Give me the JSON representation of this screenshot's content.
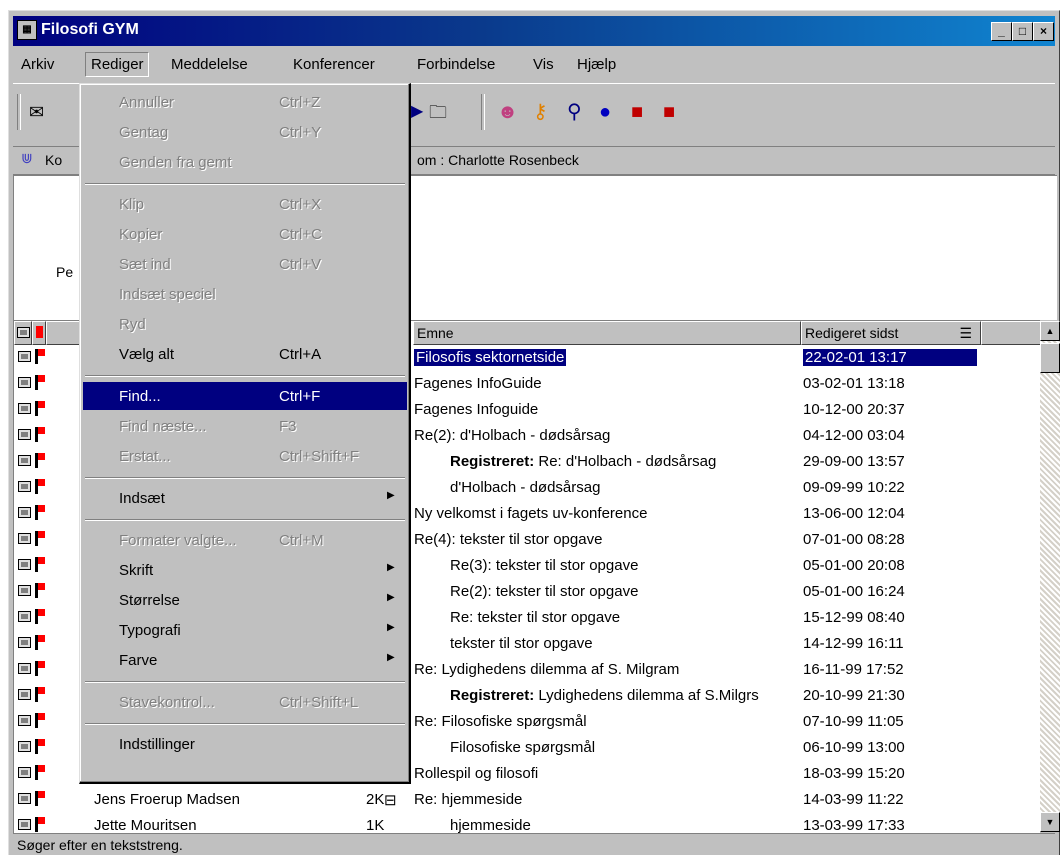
{
  "window": {
    "title": "Filosofi GYM",
    "minimize": "_",
    "maximize": "□",
    "close": "×"
  },
  "menubar": [
    "Arkiv",
    "Rediger",
    "Meddelelse",
    "Konferencer",
    "Forbindelse",
    "Vis",
    "Hjælp"
  ],
  "infobar": {
    "left": "Ko",
    "right": "om : Charlotte Rosenbeck"
  },
  "preview": {
    "fragment": "Pe"
  },
  "columns": {
    "subject": "Emne",
    "edited": "Redigeret sidst"
  },
  "rows": [
    {
      "subject": "Filosofis sektornetside",
      "date": "22-02-01 13:17",
      "sel": true
    },
    {
      "subject": "Fagenes InfoGuide",
      "date": "03-02-01 13:18"
    },
    {
      "subject": "Fagenes Infoguide",
      "date": "10-12-00 20:37"
    },
    {
      "subject": "Re(2): d'Holbach - dødsårsag",
      "date": "04-12-00 03:04"
    },
    {
      "prefix": "Registreret:",
      "subject": " Re: d'Holbach - dødsårsag",
      "date": "29-09-00 13:57",
      "indent": true
    },
    {
      "subject": "d'Holbach - dødsårsag",
      "date": "09-09-99 10:22",
      "indent": true
    },
    {
      "subject": "Ny velkomst i fagets uv-konference",
      "date": "13-06-00 12:04"
    },
    {
      "subject": "Re(4): tekster til stor opgave",
      "date": "07-01-00 08:28"
    },
    {
      "subject": "Re(3): tekster til stor opgave",
      "date": "05-01-00 20:08",
      "indent": true
    },
    {
      "subject": "Re(2): tekster til stor opgave",
      "date": "05-01-00 16:24",
      "indent": true
    },
    {
      "subject": "Re: tekster til stor opgave",
      "date": "15-12-99 08:40",
      "indent": true
    },
    {
      "subject": "tekster til stor opgave",
      "date": "14-12-99 16:11",
      "indent": true
    },
    {
      "subject": "Re: Lydighedens dilemma af S. Milgram",
      "date": "16-11-99 17:52"
    },
    {
      "prefix": "Registreret:",
      "subject": " Lydighedens dilemma af S.Milgrs",
      "date": "20-10-99 21:30",
      "indent": true
    },
    {
      "subject": "Re: Filosofiske spørgsmål",
      "date": "07-10-99 11:05"
    },
    {
      "subject": "Filosofiske spørgsmål",
      "date": "06-10-99 13:00",
      "indent": true
    },
    {
      "subject": "Rollespil og filosofi",
      "date": "18-03-99 15:20"
    },
    {
      "author": "Jens Froerup Madsen",
      "size": "2K",
      "tree": "⊟",
      "subject": "Re: hjemmeside",
      "date": "14-03-99 11:22"
    },
    {
      "author": "Jette Mouritsen",
      "size": "1K",
      "subject": "hjemmeside",
      "date": "13-03-99 17:33",
      "indent": true
    }
  ],
  "menu": [
    {
      "label": "Annuller",
      "shortcut": "Ctrl+Z",
      "disabled": true
    },
    {
      "label": "Gentag",
      "shortcut": "Ctrl+Y",
      "disabled": true
    },
    {
      "label": "Genden fra gemt",
      "disabled": true
    },
    {
      "sep": true
    },
    {
      "label": "Klip",
      "shortcut": "Ctrl+X",
      "disabled": true
    },
    {
      "label": "Kopier",
      "shortcut": "Ctrl+C",
      "disabled": true
    },
    {
      "label": "Sæt ind",
      "shortcut": "Ctrl+V",
      "disabled": true
    },
    {
      "label": "Indsæt speciel",
      "disabled": true
    },
    {
      "label": "Ryd",
      "disabled": true
    },
    {
      "label": "Vælg alt",
      "shortcut": "Ctrl+A"
    },
    {
      "sep": true
    },
    {
      "label": "Find...",
      "shortcut": "Ctrl+F",
      "highlight": true
    },
    {
      "label": "Find næste...",
      "shortcut": "F3",
      "disabled": true
    },
    {
      "label": "Erstat...",
      "shortcut": "Ctrl+Shift+F",
      "disabled": true
    },
    {
      "sep": true
    },
    {
      "label": "Indsæt",
      "submenu": true
    },
    {
      "sep": true
    },
    {
      "label": "Formater valgte...",
      "shortcut": "Ctrl+M",
      "disabled": true
    },
    {
      "label": "Skrift",
      "submenu": true
    },
    {
      "label": "Størrelse",
      "submenu": true
    },
    {
      "label": "Typografi",
      "submenu": true
    },
    {
      "label": "Farve",
      "submenu": true
    },
    {
      "sep": true
    },
    {
      "label": "Stavekontrol...",
      "shortcut": "Ctrl+Shift+L",
      "disabled": true
    },
    {
      "sep": true
    },
    {
      "label": "Indstillinger"
    }
  ],
  "status": "Søger efter en tekststreng."
}
